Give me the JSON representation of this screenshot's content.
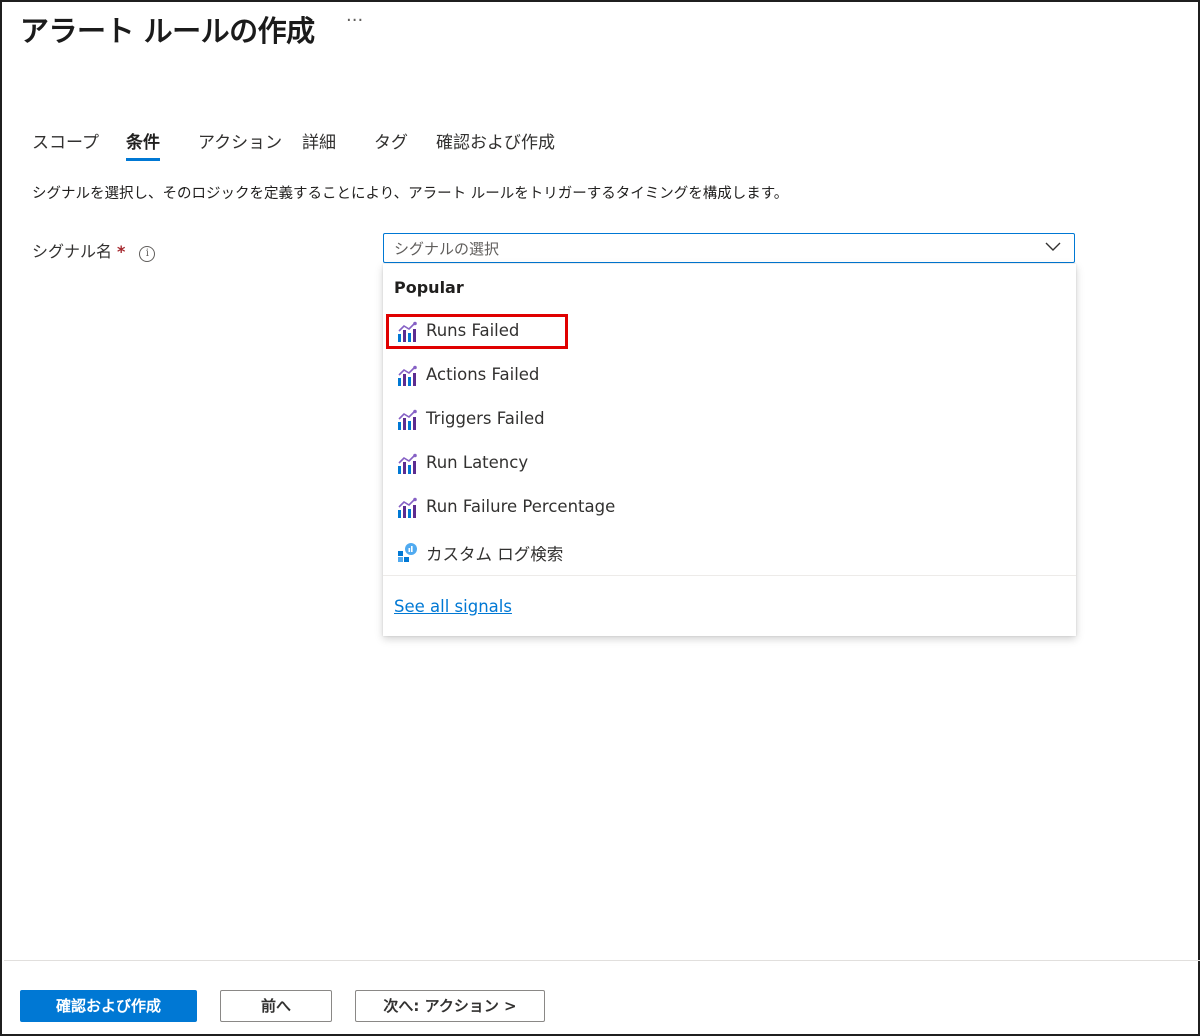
{
  "page": {
    "title": "アラート ルールの作成",
    "more_label": "···"
  },
  "tabs": [
    {
      "label": "スコープ",
      "active": false
    },
    {
      "label": "条件",
      "active": true
    },
    {
      "label": "アクション",
      "active": false
    },
    {
      "label": "詳細",
      "active": false
    },
    {
      "label": "タグ",
      "active": false
    },
    {
      "label": "確認および作成",
      "active": false
    }
  ],
  "description": "シグナルを選択し、そのロジックを定義することにより、アラート ルールをトリガーするタイミングを構成します。",
  "signal_field": {
    "label": "シグナル名",
    "required_mark": "*",
    "info_icon": "info-icon",
    "placeholder": "シグナルの選択"
  },
  "dropdown": {
    "group_header": "Popular",
    "options": [
      {
        "label": "Runs Failed",
        "icon": "metric-chart-icon",
        "highlighted": true
      },
      {
        "label": "Actions Failed",
        "icon": "metric-chart-icon"
      },
      {
        "label": "Triggers Failed",
        "icon": "metric-chart-icon"
      },
      {
        "label": "Run Latency",
        "icon": "metric-chart-icon"
      },
      {
        "label": "Run Failure Percentage",
        "icon": "metric-chart-icon"
      },
      {
        "label": "カスタム ログ検索",
        "icon": "log-search-icon"
      }
    ],
    "see_all_link": "See all signals"
  },
  "footer": {
    "review_create_button": "確認および作成",
    "previous_button": "前へ",
    "next_button": "次へ: アクション >"
  },
  "colors": {
    "accent": "#0078d4",
    "highlight_border": "#e00000",
    "required": "#a4262c",
    "icon_purple": "#8661c5",
    "icon_blue": "#0078d4"
  }
}
